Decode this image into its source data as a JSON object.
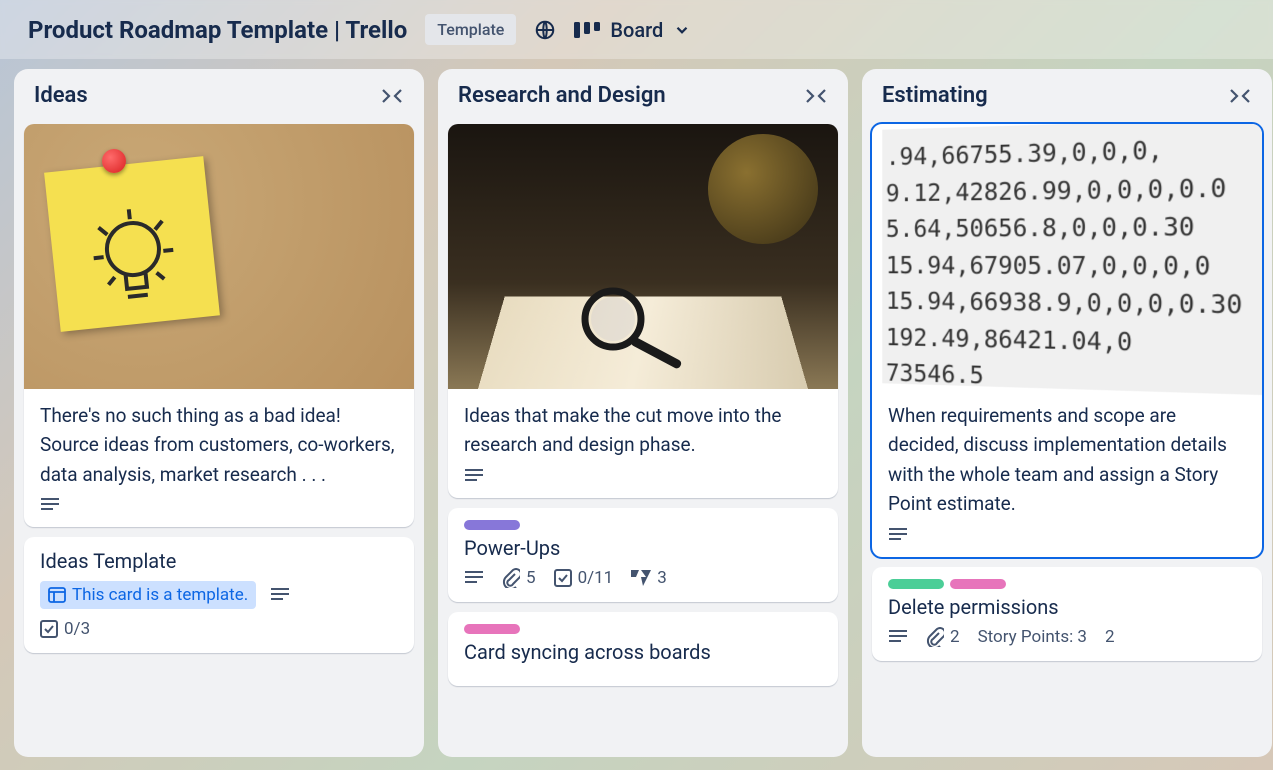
{
  "header": {
    "title": "Product Roadmap Template | Trello",
    "template_badge": "Template",
    "view_label": "Board"
  },
  "lists": [
    {
      "title": "Ideas",
      "cards": [
        {
          "text": "There's no such thing as a bad idea! Source ideas from customers, co-workers, data analysis, market research . . .",
          "has_description": true
        },
        {
          "title": "Ideas Template",
          "template_label": "This card is a template.",
          "checklist": "0/3"
        }
      ]
    },
    {
      "title": "Research and Design",
      "cards": [
        {
          "text": "Ideas that make the cut move into the research and design phase.",
          "has_description": true
        },
        {
          "title": "Power-Ups",
          "labels": [
            "#8777d9"
          ],
          "attachments": "5",
          "checklist": "0/11",
          "extra_count": "3"
        },
        {
          "title": "Card syncing across boards",
          "labels": [
            "#e774bb"
          ]
        }
      ]
    },
    {
      "title": "Estimating",
      "cards": [
        {
          "text": "When requirements and scope are decided, discuss implementation details with the whole team and assign a Story Point estimate.",
          "has_description": true,
          "selected": true
        },
        {
          "title": "Delete permissions",
          "labels": [
            "#4bce97",
            "#e774bb"
          ],
          "attachments": "2",
          "story_points_label": "Story Points: 3",
          "extra_num": "2"
        }
      ]
    }
  ],
  "cover_numbers": [
    ".94,66755.39,0,0,0,",
    "9.12,42826.99,0,0,0,0.0",
    "5.64,50656.8,0,0,0.30",
    "15.94,67905.07,0,0,0,0",
    "15.94,66938.9,0,0,0,0.30",
    "192.49,86421.04,0",
    "     73546.5"
  ]
}
